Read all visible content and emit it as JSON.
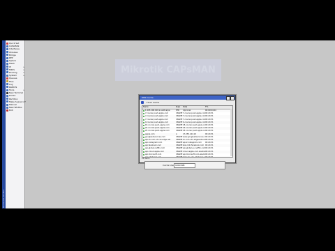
{
  "sidebar": {
    "brand_vertical": "RouterOS WinBox",
    "items": [
      {
        "label": "Quick Set",
        "color": "#d04040",
        "arrow": false
      },
      {
        "label": "CAPsMAN",
        "color": "#4070c0",
        "arrow": false
      },
      {
        "label": "Interfaces",
        "color": "#4070c0",
        "arrow": false
      },
      {
        "label": "Wireless",
        "color": "#4070c0",
        "arrow": false
      },
      {
        "label": "Bridge",
        "color": "#4070c0",
        "arrow": false
      },
      {
        "label": "PPP",
        "color": "#4070c0",
        "arrow": false
      },
      {
        "label": "Switch",
        "color": "#4070c0",
        "arrow": false
      },
      {
        "label": "Mesh",
        "color": "#4070c0",
        "arrow": false
      },
      {
        "label": "IP",
        "color": "#4070c0",
        "arrow": true
      },
      {
        "label": "MPLS",
        "color": "#4070c0",
        "arrow": true
      },
      {
        "label": "Routing",
        "color": "#4070c0",
        "arrow": true
      },
      {
        "label": "System",
        "color": "#4070c0",
        "arrow": true
      },
      {
        "label": "Queues",
        "color": "#d04040",
        "arrow": false
      },
      {
        "label": "Files",
        "color": "#c0a030",
        "arrow": false
      },
      {
        "label": "Log",
        "color": "#4070c0",
        "arrow": false
      },
      {
        "label": "RADIUS",
        "color": "#4070c0",
        "arrow": false
      },
      {
        "label": "Tools",
        "color": "#4070c0",
        "arrow": true
      },
      {
        "label": "New Terminal",
        "color": "#303030",
        "arrow": false
      },
      {
        "label": "Dot1X",
        "color": "#4070c0",
        "arrow": false
      },
      {
        "label": "Partition",
        "color": "#4070c0",
        "arrow": false
      },
      {
        "label": "Make Supout.rif",
        "color": "#4070c0",
        "arrow": false
      },
      {
        "label": "Manual",
        "color": "#4070c0",
        "arrow": false
      },
      {
        "label": "New WinBox",
        "color": "#4070c0",
        "arrow": false
      },
      {
        "label": "Exit",
        "color": "#c03030",
        "arrow": false
      }
    ]
  },
  "watermark": "Mikrotik CAPsMAN",
  "dns_window": {
    "title": "DNS Cache",
    "toolbar_label": "Flush Cache",
    "columns": [
      "Name",
      "Type",
      "Data",
      "TTL"
    ],
    "rows": [
      {
        "name": "1.205.100.100.in-addr.arpa",
        "type": "PTR",
        "data": "ntp.local",
        "ttl": "00:09:04:04"
      },
      {
        "name": "7.courier-push-apple.com",
        "type": "CNAME",
        "data": "7-courier.push.apple.com",
        "ttl": "00:24:51"
      },
      {
        "name": "7-courier.push.apple.com",
        "type": "CNAME",
        "data": "7.courier.push.apple.com",
        "ttl": "00:24:51"
      },
      {
        "name": "7.courier.push.apple.com",
        "type": "CNAME",
        "data": "7-courier.push.apple.com",
        "ttl": "00:24:51"
      },
      {
        "name": "9.courier-push-apple.com",
        "type": "CNAME",
        "data": "9-courier.push.apple.com",
        "ttl": "00:24:51"
      },
      {
        "name": "18.courier-push-apple.com",
        "type": "CNAME",
        "data": "18-courier.push.apple.com",
        "ttl": "00:24:51"
      },
      {
        "name": "24.courier-push-apple.com",
        "type": "CNAME",
        "data": "24-courier.push.apple.com",
        "ttl": "00:24:51"
      },
      {
        "name": "25.courier-push-apple.com",
        "type": "CNAME",
        "data": "25-courier.push.apple.com",
        "ttl": "00:24:51"
      },
      {
        "name": "apple.com",
        "type": "A",
        "data": "17.253.144.10",
        "ttl": "00:24:51"
      },
      {
        "name": "googleadservices.com",
        "type": "CNAME",
        "data": "www.googleadservices.com",
        "ttl": "00:24:51"
      },
      {
        "name": "api.vk.com.cdn.vk-edge.net",
        "type": "CNAME",
        "data": "vk.com.cdn.edgesuite.net",
        "ttl": "00:24:51"
      },
      {
        "name": "api.instagram.com",
        "type": "CNAME",
        "data": "api-2.instagram.com",
        "ttl": "00:24:51"
      },
      {
        "name": "api.facebook.com",
        "type": "CNAME",
        "data": "star.c10r.facebook.com",
        "ttl": "00:24:51"
      },
      {
        "name": "api-global.netflix.com",
        "type": "CNAME",
        "data": "api-global.eu.netflix.com",
        "ttl": "00:24:51"
      },
      {
        "name": "api.icloud.apple.com",
        "type": "CNAME",
        "data": "icloud.apple.com.akadns.net",
        "ttl": "00:24:51"
      },
      {
        "name": "api.microsoft.com",
        "type": "CNAME",
        "data": "api.microsoft.com.akadns.net",
        "ttl": "00:24:51"
      },
      {
        "name": "api.whatsapp.net",
        "type": "CNAME",
        "data": "mmx-ds.cdn.whatsapp.net",
        "ttl": "00:24:51"
      },
      {
        "name": "apple.com",
        "type": "A",
        "data": "17.253.144.10",
        "ttl": "00:24:51"
      }
    ],
    "status": "18 items"
  },
  "subpanel": {
    "label": "Cache Used:",
    "value": "1010 KiB"
  }
}
